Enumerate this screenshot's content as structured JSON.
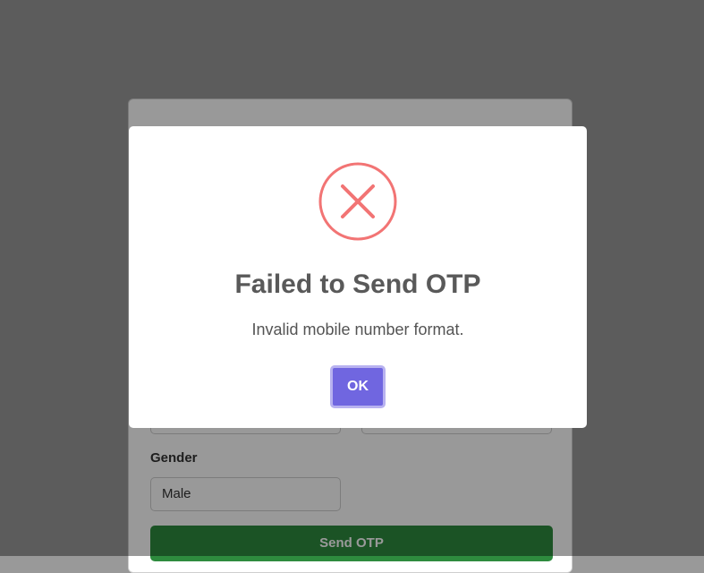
{
  "form": {
    "gender_label": "Gender",
    "gender_value": "Male",
    "send_otp_label": "Send OTP"
  },
  "dialog": {
    "icon": "error-x-icon",
    "title": "Failed to Send OTP",
    "message": "Invalid mobile number format.",
    "ok_label": "OK"
  },
  "colors": {
    "overlay": "#999999",
    "error_icon": "#f27474",
    "ok_button": "#7066e0",
    "send_button": "#2e8b3e"
  }
}
